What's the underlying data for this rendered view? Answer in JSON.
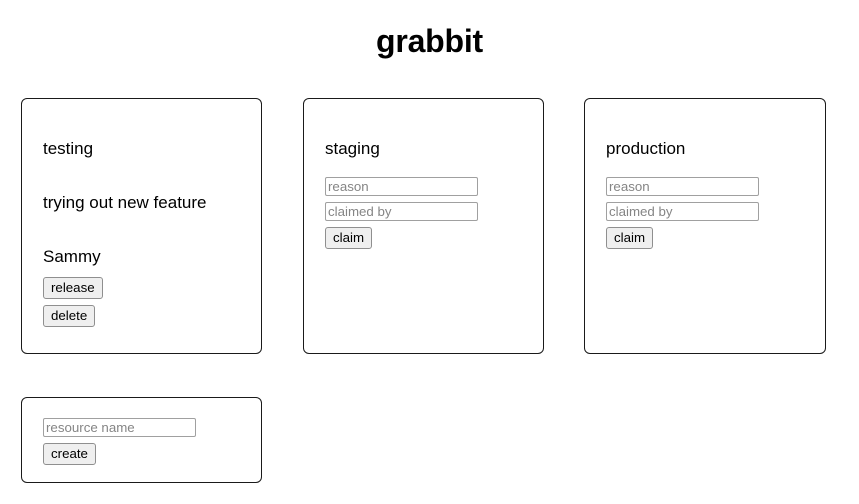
{
  "app": {
    "title": "grabbit"
  },
  "resources": [
    {
      "name": "testing",
      "state": "claimed",
      "reason": "trying out new feature",
      "claimed_by": "Sammy",
      "actions": {
        "release_label": "release",
        "delete_label": "delete"
      }
    },
    {
      "name": "staging",
      "state": "free",
      "form": {
        "reason_placeholder": "reason",
        "reason_value": "",
        "claimed_by_placeholder": "claimed by",
        "claimed_by_value": "",
        "claim_label": "claim"
      }
    },
    {
      "name": "production",
      "state": "free",
      "form": {
        "reason_placeholder": "reason",
        "reason_value": "",
        "claimed_by_placeholder": "claimed by",
        "claimed_by_value": "",
        "claim_label": "claim"
      }
    }
  ],
  "create_resource": {
    "name_placeholder": "resource name",
    "name_value": "",
    "create_label": "create"
  },
  "colors": {
    "background": "#ffffff",
    "text": "#000000",
    "card_border": "#1a1a1a",
    "input_border": "#a0a0a0",
    "placeholder_text": "#858585",
    "button_face": "#efefef",
    "button_border": "#8f8f8f"
  }
}
